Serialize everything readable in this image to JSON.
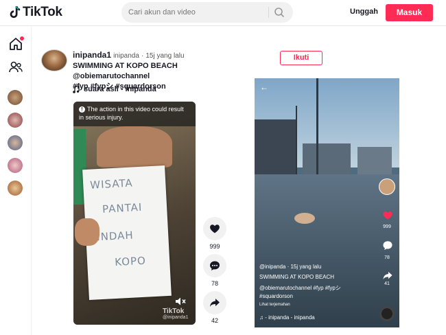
{
  "header": {
    "brand": "TikTok",
    "search_placeholder": "Cari akun dan video",
    "upload_label": "Unggah",
    "login_label": "Masuk",
    "accent_color": "#fe2c55"
  },
  "sidebar": {
    "icons": [
      "home-icon",
      "following-icon"
    ],
    "accounts": [
      "avatar-1",
      "avatar-2",
      "avatar-3",
      "avatar-4",
      "avatar-5"
    ]
  },
  "post": {
    "username": "inipanda1",
    "nickname": "inipanda",
    "time": "15j yang lalu",
    "caption_line1": "SWIMMING AT KOPO BEACH @obiemarutochannel",
    "caption_line2": "#fyp #fypシ #squardorson",
    "music": "suara asli - inipanda",
    "follow_label": "Ikuti",
    "warning_text": "The action in this video could result in serious injury.",
    "sign_lines": [
      "WISATA",
      "PANTAI",
      "INDAH",
      "KOPO"
    ],
    "watermark": "TikTok",
    "watermark_user": "@inipanda1",
    "likes": "999",
    "comments": "78",
    "shares": "42"
  },
  "preview": {
    "user_line": "@inipanda · 15j yang lalu",
    "caption1": "SWIMMING AT KOPO BEACH",
    "caption2": "@obiemarutochannel #fyp #fypシ",
    "caption3": "#squardorson",
    "translate": "Lihat terjemahan",
    "music": "- inipanda - inipanda",
    "likes": "999",
    "comments": "78",
    "shares": "41"
  }
}
